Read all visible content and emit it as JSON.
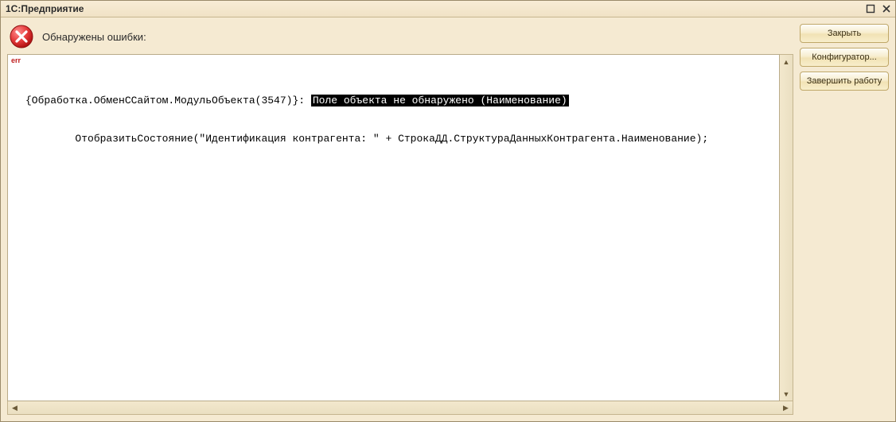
{
  "window": {
    "title": "1С:Предприятие"
  },
  "header": {
    "text": "Обнаружены ошибки:"
  },
  "error": {
    "tag": "err",
    "line1_prefix": "{Обработка.ОбменССайтом.МодульОбъекта(3547)}: ",
    "line1_highlight": "Поле объекта не обнаружено (Наименование)",
    "line2": "        ОтобразитьСостояние(\"Идентификация контрагента: \" + СтрокаДД.СтруктураДанныхКонтрагента.Наименование);"
  },
  "buttons": {
    "close": "Закрыть",
    "configurator": "Конфигуратор...",
    "shutdown": "Завершить работу"
  },
  "scroll": {
    "up": "▲",
    "down": "▼",
    "left": "◀",
    "right": "▶"
  }
}
